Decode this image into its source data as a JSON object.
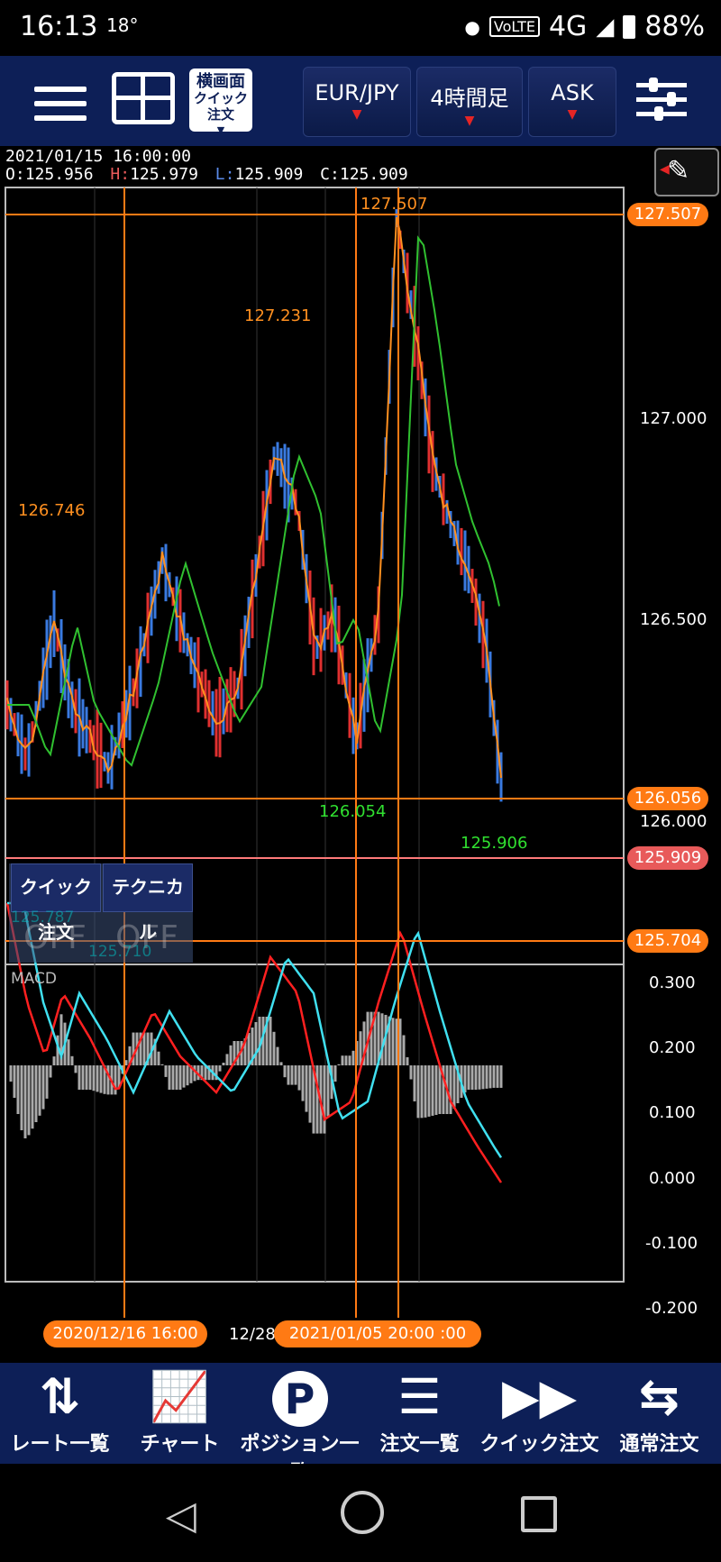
{
  "status_bar": {
    "time": "16:13",
    "temperature": "18°",
    "network": "4G",
    "volte": "VoLTE",
    "battery": "88%"
  },
  "toolbar": {
    "menu_icon": "hamburger-icon",
    "layout_icon": "grid-layout-icon",
    "landscape_quick_order_line1": "横画面",
    "landscape_quick_order_line2": "クイック注文",
    "pair_label": "EUR/JPY",
    "timeframe_label": "4時間足",
    "price_type_label": "ASK",
    "settings_icon": "sliders-icon"
  },
  "ohlc": {
    "datetime": "2021/01/15 16:00:00",
    "o_label": "O:",
    "o": "125.956",
    "h_label": "H:",
    "h": "125.979",
    "l_label": "L:",
    "l": "125.909",
    "c_label": "C:",
    "c": "125.909"
  },
  "price_tags": {
    "high": "127.507",
    "level_mid": "126.056",
    "current": "125.909",
    "low": "125.704"
  },
  "price_axis": [
    "127.000",
    "126.500",
    "126.000"
  ],
  "annotations": {
    "peak1": "127.507",
    "peak2": "127.231",
    "peak3": "126.746",
    "trough_green": "126.054",
    "trough_last": "125.906",
    "hidden1": "125.787",
    "hidden2": "125.710"
  },
  "macd": {
    "label": "MACD",
    "axis": [
      "0.300",
      "0.200",
      "0.100",
      "0.000",
      "-0.100",
      "-0.200"
    ]
  },
  "quick_panel": {
    "quick_order": "クイック注文",
    "technical": "テクニカル",
    "off1": "OFF",
    "off2": "OFF"
  },
  "date_tags": {
    "left": "2020/12/16 16:00",
    "mid_partial": "12/28",
    "right": "2021/01/05 20:00",
    "right_partial": ":00"
  },
  "bottom_nav": [
    {
      "label": "レート一覧",
      "icon": "rate-list-icon"
    },
    {
      "label": "チャート",
      "icon": "chart-icon"
    },
    {
      "label": "ポジション一覧",
      "icon": "position-icon"
    },
    {
      "label": "注文一覧",
      "icon": "order-list-icon"
    },
    {
      "label": "クイック注文",
      "icon": "quick-order-icon"
    },
    {
      "label": "通常注文",
      "icon": "normal-order-icon"
    }
  ],
  "colors": {
    "toolbar": "#0d1f57",
    "orange": "#ff7a14",
    "red_tag": "#e85a5a",
    "candle_up": "#e03030",
    "candle_down": "#3a7ae0",
    "ma_fast": "#ff9020",
    "ma_slow": "#30c030",
    "macd_line": "#ff2020",
    "signal_line": "#40e0f0"
  }
}
